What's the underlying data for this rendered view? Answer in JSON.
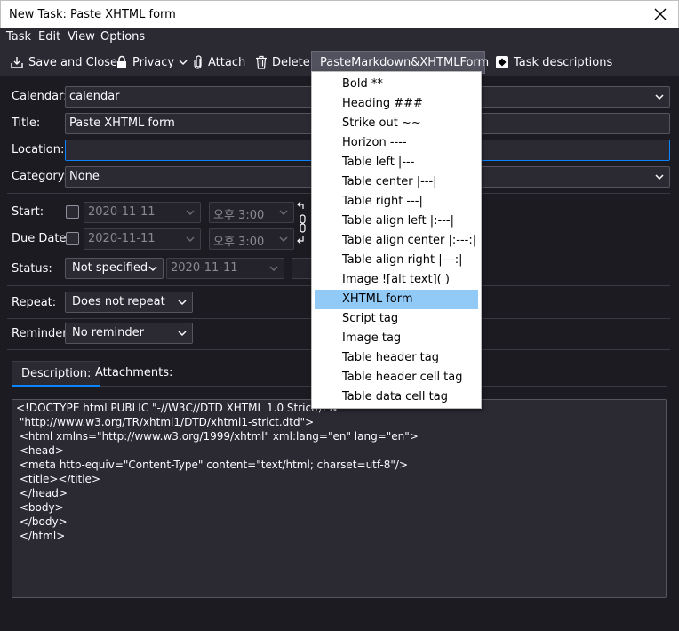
{
  "window": {
    "title": "New Task: Paste XHTML form"
  },
  "menu": [
    "Task",
    "Edit",
    "View",
    "Options"
  ],
  "toolbar": {
    "save_close": "Save and Close",
    "privacy": "Privacy",
    "attach": "Attach",
    "delete": "Delete",
    "paste_md": "PasteMarkdown&XHTMLForm",
    "task_desc": "Task descriptions"
  },
  "form": {
    "calendar": {
      "label": "Calendar:",
      "value": "calendar"
    },
    "title": {
      "label": "Title:",
      "value": "Paste XHTML form"
    },
    "location": {
      "label": "Location:",
      "value": ""
    },
    "category": {
      "label": "Category:",
      "value": "None"
    },
    "start": {
      "label": "Start:",
      "date": "2020-11-11",
      "time": "오후 3:00"
    },
    "due": {
      "label": "Due Date:",
      "date": "2020-11-11",
      "time": "오후 3:00"
    },
    "status": {
      "label": "Status:",
      "value": "Not specified",
      "date": "2020-11-11"
    },
    "repeat": {
      "label": "Repeat:",
      "value": "Does not repeat"
    },
    "reminder": {
      "label": "Reminder:",
      "value": "No reminder"
    }
  },
  "tabs": [
    "Description:",
    "Attachments:"
  ],
  "description": "<!DOCTYPE html PUBLIC \"-//W3C//DTD XHTML 1.0 Strict//EN\"\n \"http://www.w3.org/TR/xhtml1/DTD/xhtml1-strict.dtd\">\n <html xmlns=\"http://www.w3.org/1999/xhtml\" xml:lang=\"en\" lang=\"en\">\n <head>\n <meta http-equiv=\"Content-Type\" content=\"text/html; charset=utf-8\"/>\n <title></title>\n </head>\n <body>\n </body>\n </html>",
  "popup": {
    "items": [
      "Bold **",
      "Heading ###",
      "Strike out ~~",
      "Horizon ----",
      "Table left |---",
      "Table center |---|",
      "Table right ---|",
      "Table align left |:---|",
      "Table align center |:---:|",
      "Table align right |---:|",
      "Image ![alt text]( )",
      "XHTML form",
      "Script tag",
      "Image tag",
      "Table header tag",
      "Table header cell tag",
      "Table data cell tag"
    ],
    "highlighted": "XHTML form"
  },
  "colors": {
    "background": "#1c1b22",
    "panel": "#2b2a33",
    "accent": "#0a84ff",
    "highlight": "#91c9f7"
  }
}
